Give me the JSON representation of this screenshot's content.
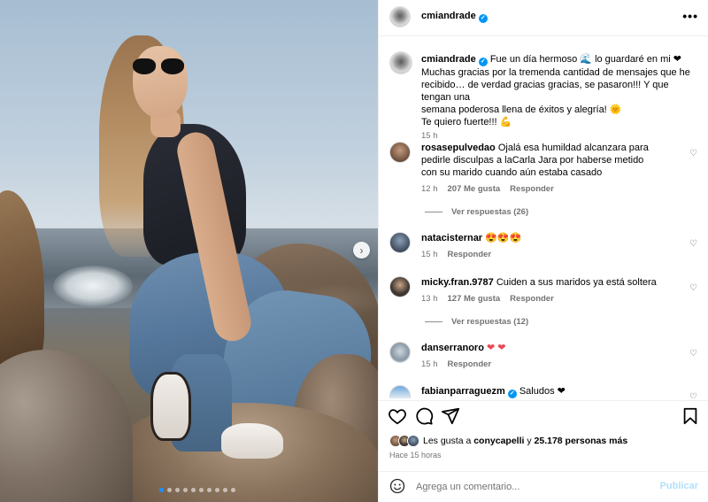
{
  "post": {
    "username": "cmiandrade",
    "more_label": "•••",
    "caption_lines": [
      "Fue un día hermoso 🌊 lo guardaré en mi ❤",
      "Muchas gracias por la tremenda cantidad de mensajes que he",
      "recibido… de verdad gracias gracias, se pasaron!!! Y que tengan una",
      "semana poderosa llena de éxitos y alegría! 🌞",
      "Te quiero fuerte!!! 💪"
    ],
    "caption_time": "15 h"
  },
  "carousel": {
    "next_label": "›",
    "dot_count": 10,
    "active_dot": 0
  },
  "comments": [
    {
      "username": "rosasepulvedao",
      "text": "Ojalá esa humildad alcanzara para pedirle disculpas a laCarla Jara por haberse metido con su marido cuando aún estaba casado",
      "time": "12 h",
      "likes": "207 Me gusta",
      "reply": "Responder",
      "view_replies": "Ver respuestas (26)"
    },
    {
      "username": "natacisternar",
      "text": "😍😍😍",
      "time": "15 h",
      "likes": "",
      "reply": "Responder"
    },
    {
      "username": "micky.fran.9787",
      "text": "Cuiden a sus maridos ya está soltera",
      "time": "13 h",
      "likes": "127 Me gusta",
      "reply": "Responder",
      "view_replies": "Ver respuestas (12)"
    },
    {
      "username": "danserranoro",
      "text": "❤ ❤",
      "time": "15 h",
      "likes": "",
      "reply": "Responder"
    },
    {
      "username": "fabianparraguezm",
      "text": "Saludos ❤",
      "time": "",
      "likes": "",
      "reply": ""
    }
  ],
  "likes": {
    "prefix": "Les gusta a",
    "first_user": "conycapelli",
    "connector": "y",
    "others": "25.178 personas más",
    "when": "Hace 15 horas"
  },
  "add_comment": {
    "placeholder": "Agrega un comentario...",
    "post_label": "Publicar"
  },
  "icons": {
    "like": "heart-outline-icon",
    "comment": "comment-bubble-icon",
    "share": "paper-plane-icon",
    "save": "bookmark-icon",
    "emoji": "smiley-icon",
    "comment_like": "heart-small-icon",
    "verified": "verified-badge-icon"
  },
  "colors": {
    "verified": "#0095f6",
    "muted": "#737373",
    "post_button": "#b2dffc",
    "carousel_active_dot": "#1e90ff",
    "heart": "#ed4956"
  }
}
